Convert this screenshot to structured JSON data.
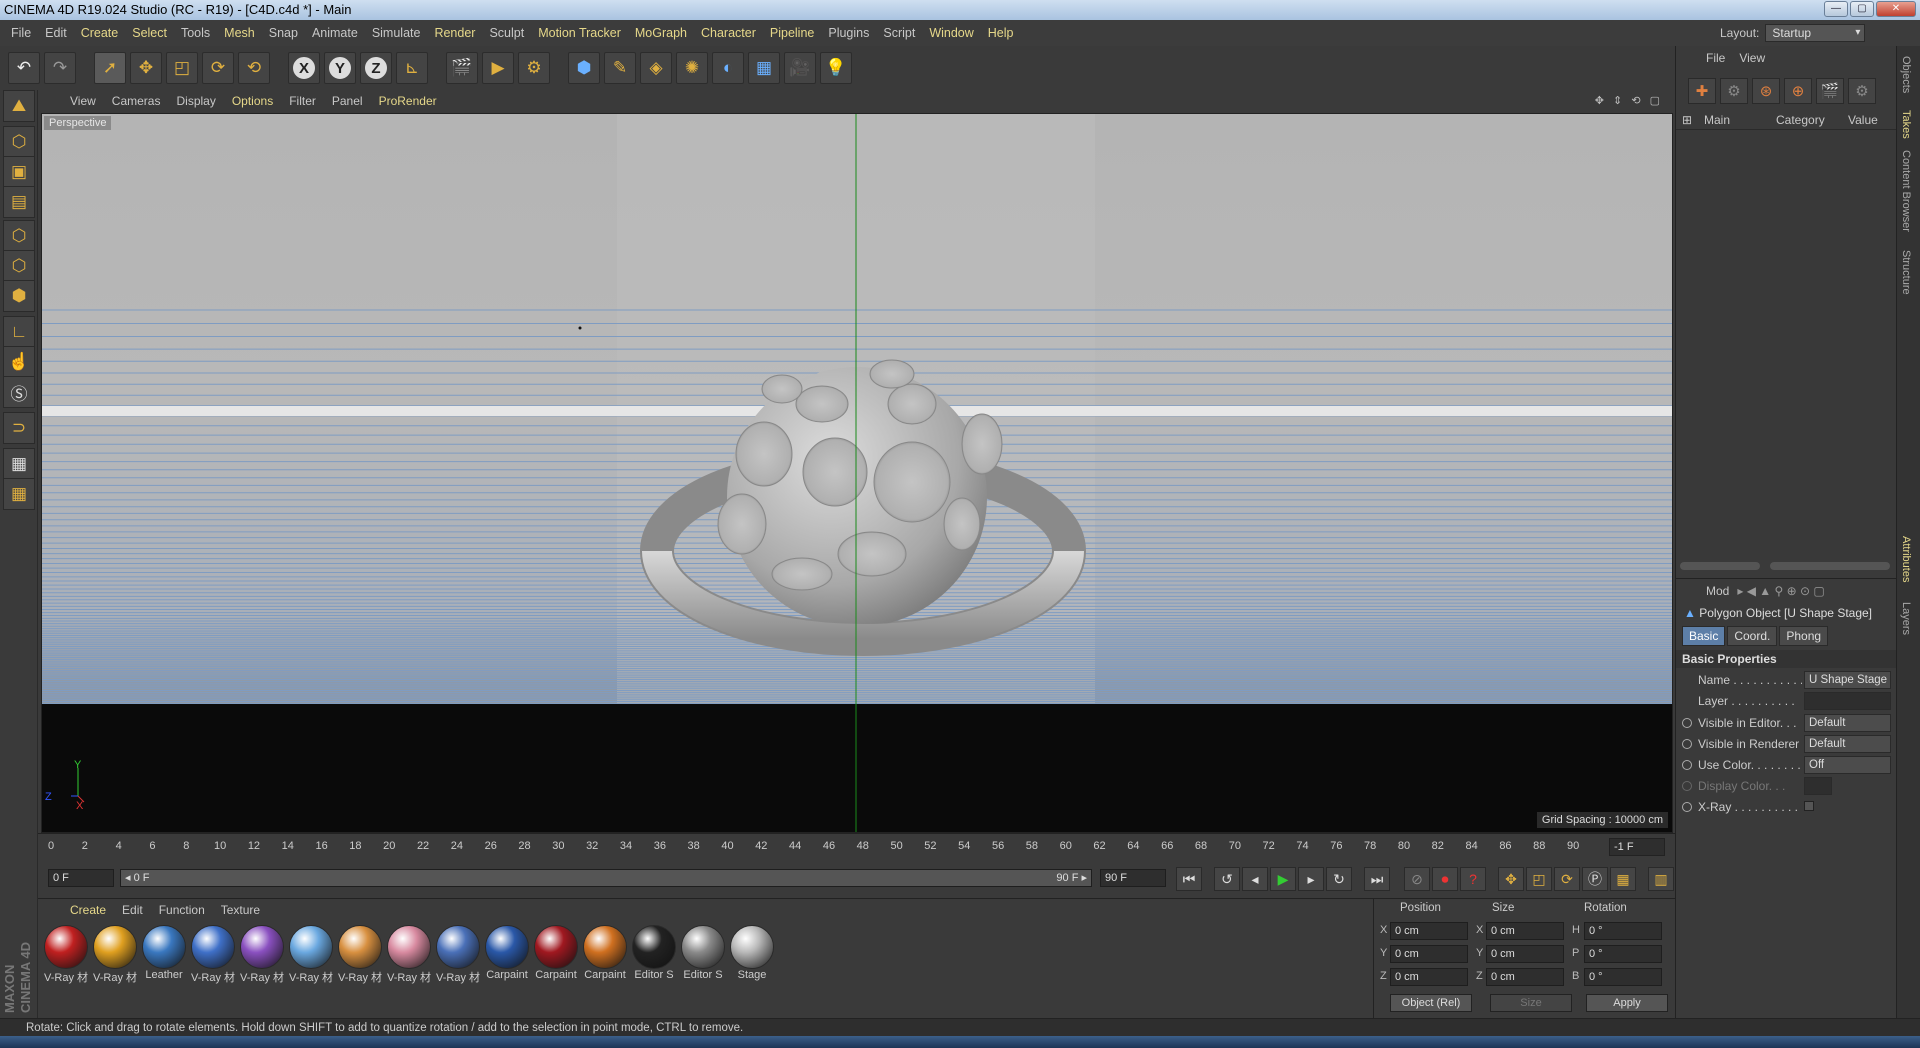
{
  "window": {
    "title": "CINEMA 4D R19.024 Studio (RC - R19) - [C4D.c4d *] - Main",
    "buttons": [
      "—",
      "▢",
      "✕"
    ]
  },
  "menubar": {
    "items": [
      "File",
      "Edit",
      "Create",
      "Select",
      "Tools",
      "Mesh",
      "Snap",
      "Animate",
      "Simulate",
      "Render",
      "Sculpt",
      "Motion Tracker",
      "MoGraph",
      "Character",
      "Pipeline",
      "Plugins",
      "Script",
      "Window",
      "Help"
    ]
  },
  "layout": {
    "label": "Layout:",
    "value": "Startup"
  },
  "viewport": {
    "menu": [
      "View",
      "Cameras",
      "Display",
      "Options",
      "Filter",
      "Panel",
      "ProRender"
    ],
    "camera_label": "Perspective",
    "grid_spacing": "Grid Spacing : 10000 cm",
    "axis_y": "Y",
    "axis_x": "X",
    "axis_z": "Z"
  },
  "timeline": {
    "ticks": [
      "0",
      "2",
      "4",
      "6",
      "8",
      "10",
      "12",
      "14",
      "16",
      "18",
      "20",
      "22",
      "24",
      "26",
      "28",
      "30",
      "32",
      "34",
      "36",
      "38",
      "40",
      "42",
      "44",
      "46",
      "48",
      "50",
      "52",
      "54",
      "56",
      "58",
      "60",
      "62",
      "64",
      "66",
      "68",
      "70",
      "72",
      "74",
      "76",
      "78",
      "80",
      "82",
      "84",
      "86",
      "88",
      "90"
    ],
    "end_field": "-1 F",
    "current_frame": "0 F",
    "range_start": "◂ 0 F",
    "range_end": "90 F ▸",
    "max_frame": "90 F"
  },
  "materials": {
    "menu": [
      "Create",
      "Edit",
      "Function",
      "Texture"
    ],
    "items": [
      {
        "name": "V-Ray 材",
        "color": "#c02020"
      },
      {
        "name": "V-Ray 材",
        "color": "#e0a020"
      },
      {
        "name": "Leather",
        "color": "#3a78c0"
      },
      {
        "name": "V-Ray 材",
        "color": "#3f70c8"
      },
      {
        "name": "V-Ray 材",
        "color": "#8a50c0"
      },
      {
        "name": "V-Ray 材",
        "color": "#6aa8e0"
      },
      {
        "name": "V-Ray 材",
        "color": "#d89040"
      },
      {
        "name": "V-Ray 材",
        "color": "#d88aa0"
      },
      {
        "name": "V-Ray 材",
        "color": "#4a70b8"
      },
      {
        "name": "Carpaint",
        "color": "#2a58a8"
      },
      {
        "name": "Carpaint",
        "color": "#a01820"
      },
      {
        "name": "Carpaint",
        "color": "#d07020"
      },
      {
        "name": "Editor S",
        "color": "#222222"
      },
      {
        "name": "Editor S",
        "color": "#8a8a8a"
      },
      {
        "name": "Stage",
        "color": "#b8b8b8"
      }
    ]
  },
  "coords": {
    "headers": [
      "Position",
      "Size",
      "Rotation"
    ],
    "rows": [
      {
        "a1": "X",
        "v1": "0 cm",
        "a2": "X",
        "v2": "0 cm",
        "a3": "H",
        "v3": "0 °"
      },
      {
        "a1": "Y",
        "v1": "0 cm",
        "a2": "Y",
        "v2": "0 cm",
        "a3": "P",
        "v3": "0 °"
      },
      {
        "a1": "Z",
        "v1": "0 cm",
        "a2": "Z",
        "v2": "0 cm",
        "a3": "B",
        "v3": "0 °"
      }
    ],
    "mode": "Object (Rel)",
    "size_mode": "Size",
    "apply": "Apply"
  },
  "objects_panel": {
    "menu": [
      "File",
      "View"
    ],
    "columns": [
      "Main",
      "Category",
      "Value"
    ]
  },
  "attributes": {
    "menu": "Mod",
    "title": "Polygon Object [U Shape Stage]",
    "tabs": [
      "Basic",
      "Coord.",
      "Phong"
    ],
    "section": "Basic Properties",
    "props": [
      {
        "label": "Name . . . . . . . . . . .",
        "value": "U Shape Stage"
      },
      {
        "label": "Layer . . . . . . . . . .",
        "value": ""
      },
      {
        "label": "Visible in Editor. . .",
        "value": "Default"
      },
      {
        "label": "Visible in Renderer",
        "value": "Default"
      },
      {
        "label": "Use Color. . . . . . . .",
        "value": "Off"
      },
      {
        "label": "Display Color. . .",
        "value": ""
      },
      {
        "label": "X-Ray . . . . . . . . . .",
        "value": ""
      }
    ]
  },
  "side_tabs": [
    "Objects",
    "Takes",
    "Content Browser",
    "Structure",
    "Attributes",
    "Layers"
  ],
  "status": "Rotate: Click and drag to rotate elements. Hold down SHIFT to add to quantize rotation / add to the selection in point mode, CTRL to remove.",
  "brand": "MAXON CINEMA 4D"
}
